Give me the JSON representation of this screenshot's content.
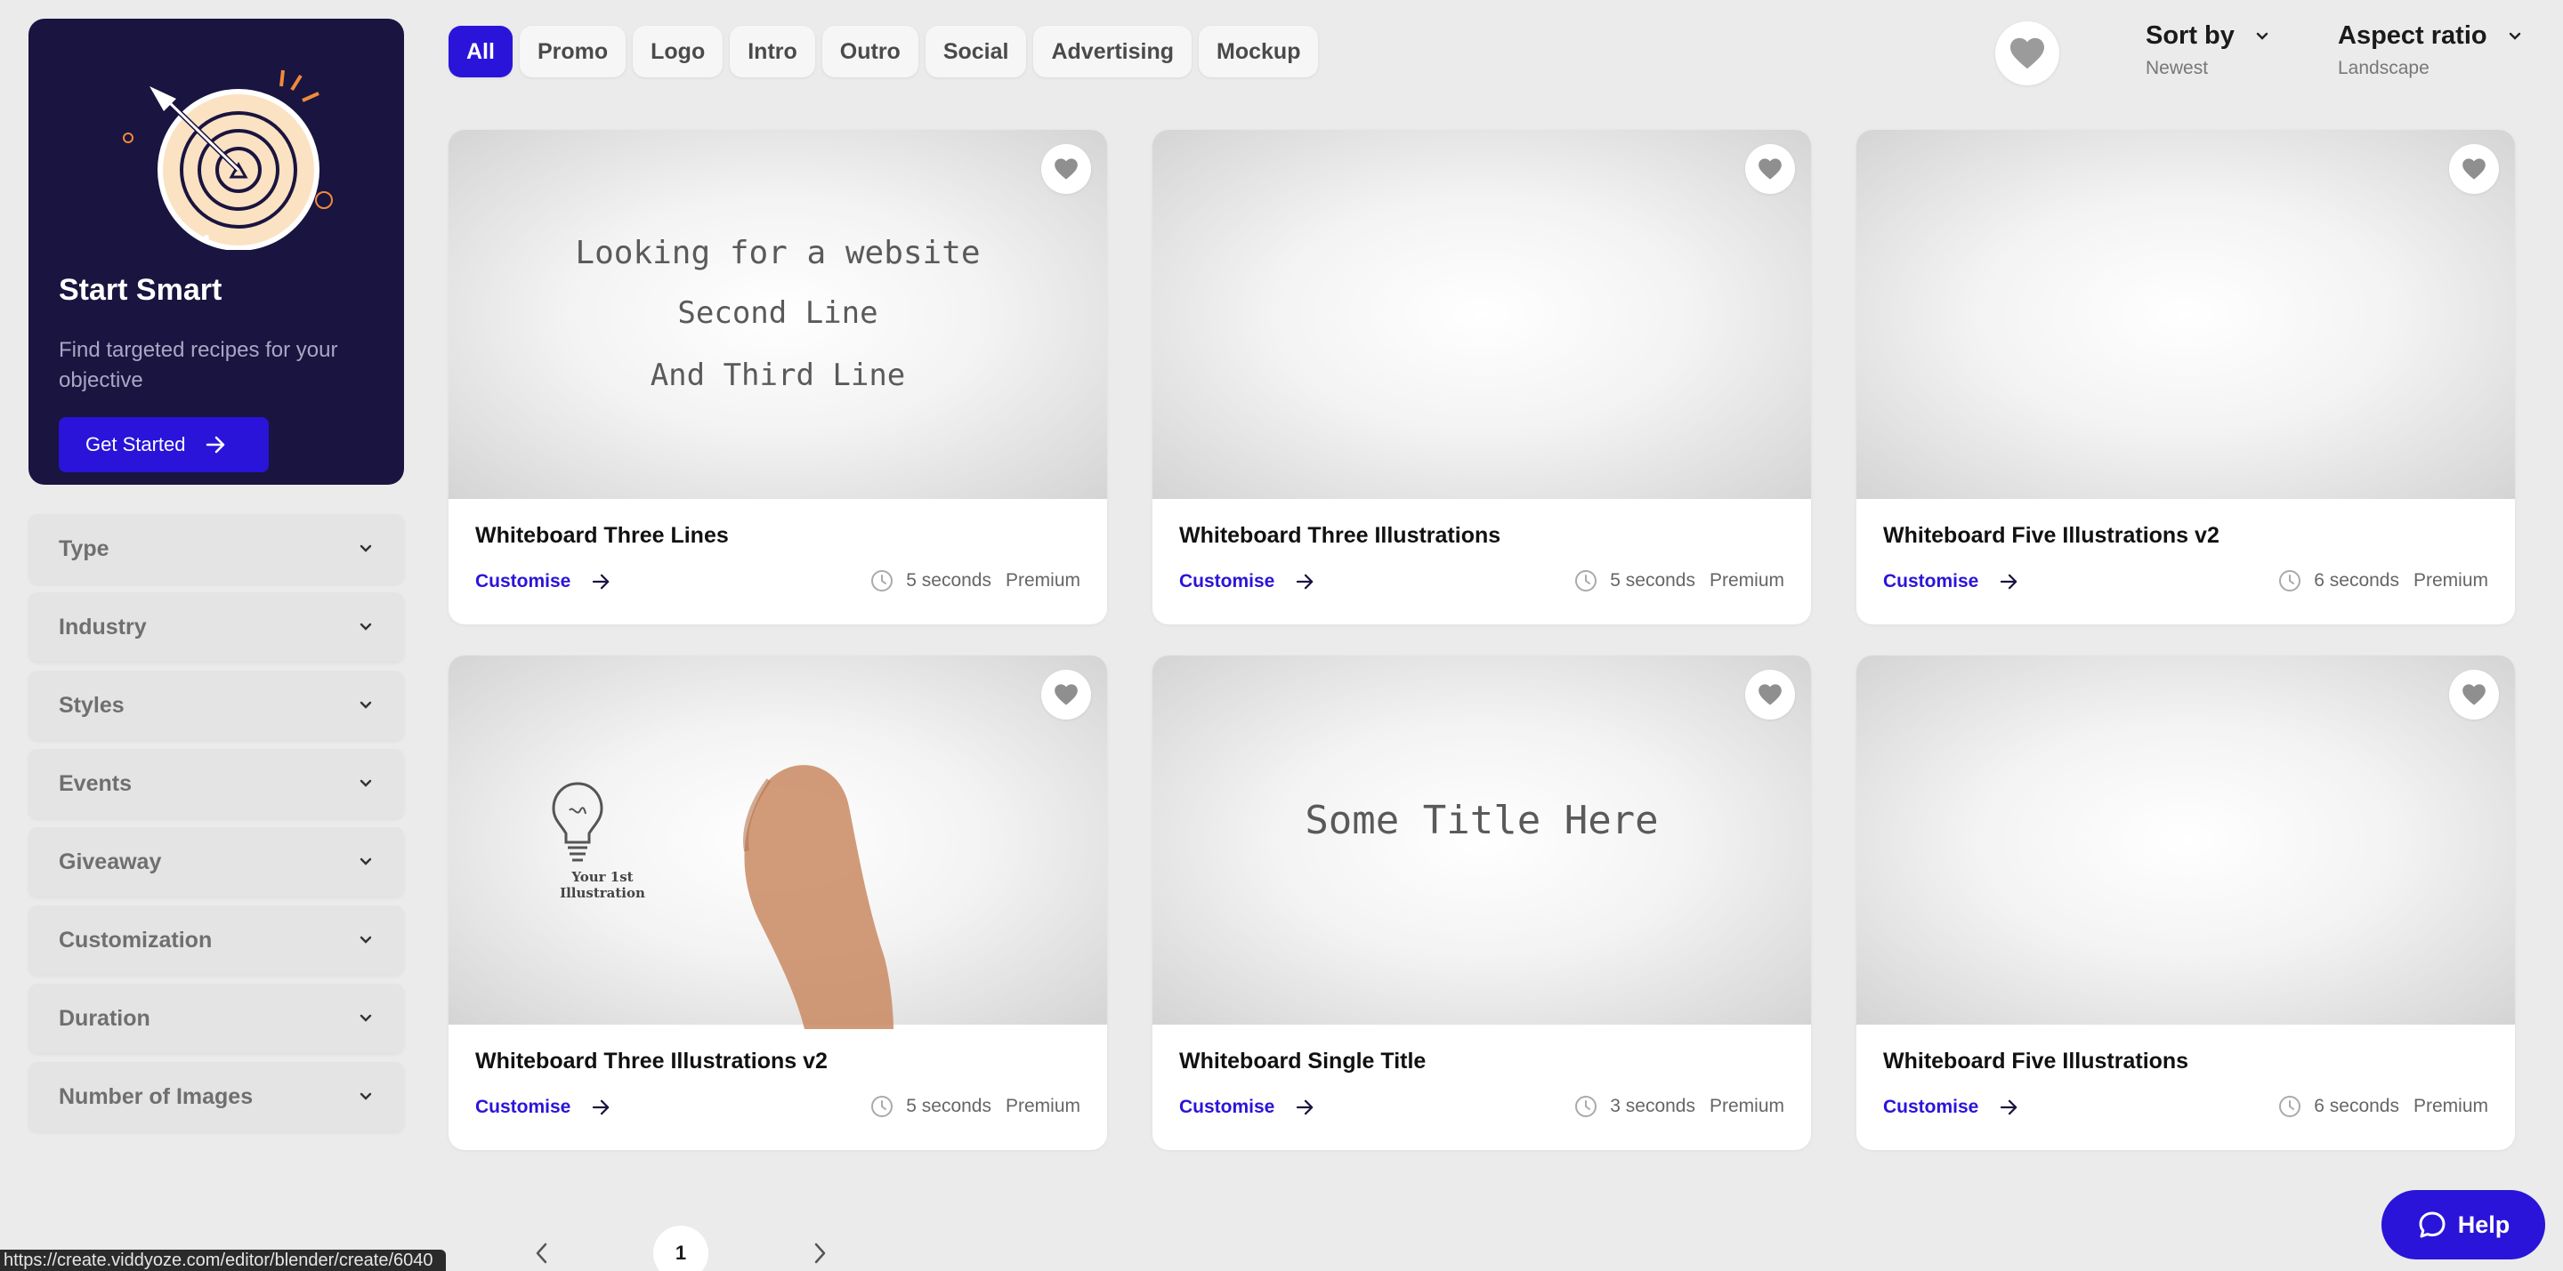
{
  "promo": {
    "title": "Start Smart",
    "description": "Find targeted recipes for your objective",
    "button_label": "Get Started"
  },
  "filters": [
    {
      "label": "Type"
    },
    {
      "label": "Industry"
    },
    {
      "label": "Styles"
    },
    {
      "label": "Events"
    },
    {
      "label": "Giveaway"
    },
    {
      "label": "Customization"
    },
    {
      "label": "Duration"
    },
    {
      "label": "Number of Images"
    }
  ],
  "tabs": [
    {
      "label": "All",
      "active": true
    },
    {
      "label": "Promo"
    },
    {
      "label": "Logo"
    },
    {
      "label": "Intro"
    },
    {
      "label": "Outro"
    },
    {
      "label": "Social"
    },
    {
      "label": "Advertising"
    },
    {
      "label": "Mockup"
    }
  ],
  "sort": {
    "title": "Sort by",
    "value": "Newest"
  },
  "aspect": {
    "title": "Aspect ratio",
    "value": "Landscape"
  },
  "cards": [
    {
      "title": "Whiteboard Three Lines",
      "cta": "Customise",
      "duration": "5 seconds",
      "tier": "Premium",
      "thumb_lines": [
        "Looking for a website",
        "Second Line",
        "And Third Line"
      ]
    },
    {
      "title": "Whiteboard Three Illustrations",
      "cta": "Customise",
      "duration": "5 seconds",
      "tier": "Premium"
    },
    {
      "title": "Whiteboard Five Illustrations v2",
      "cta": "Customise",
      "duration": "6 seconds",
      "tier": "Premium"
    },
    {
      "title": "Whiteboard Three Illustrations v2",
      "cta": "Customise",
      "duration": "5 seconds",
      "tier": "Premium",
      "thumb_caption": [
        "Your 1st",
        "Illustration"
      ]
    },
    {
      "title": "Whiteboard Single Title",
      "cta": "Customise",
      "duration": "3 seconds",
      "tier": "Premium",
      "thumb_lines": [
        "Some Title Here"
      ]
    },
    {
      "title": "Whiteboard Five Illustrations",
      "cta": "Customise",
      "duration": "6 seconds",
      "tier": "Premium"
    }
  ],
  "pagination": {
    "current": "1"
  },
  "status_url": "https://create.viddyoze.com/editor/blender/create/6040",
  "help": {
    "label": "Help"
  },
  "colors": {
    "accent": "#2a14d9",
    "promo_bg": "#1a1440",
    "page_bg": "#ebebeb"
  }
}
